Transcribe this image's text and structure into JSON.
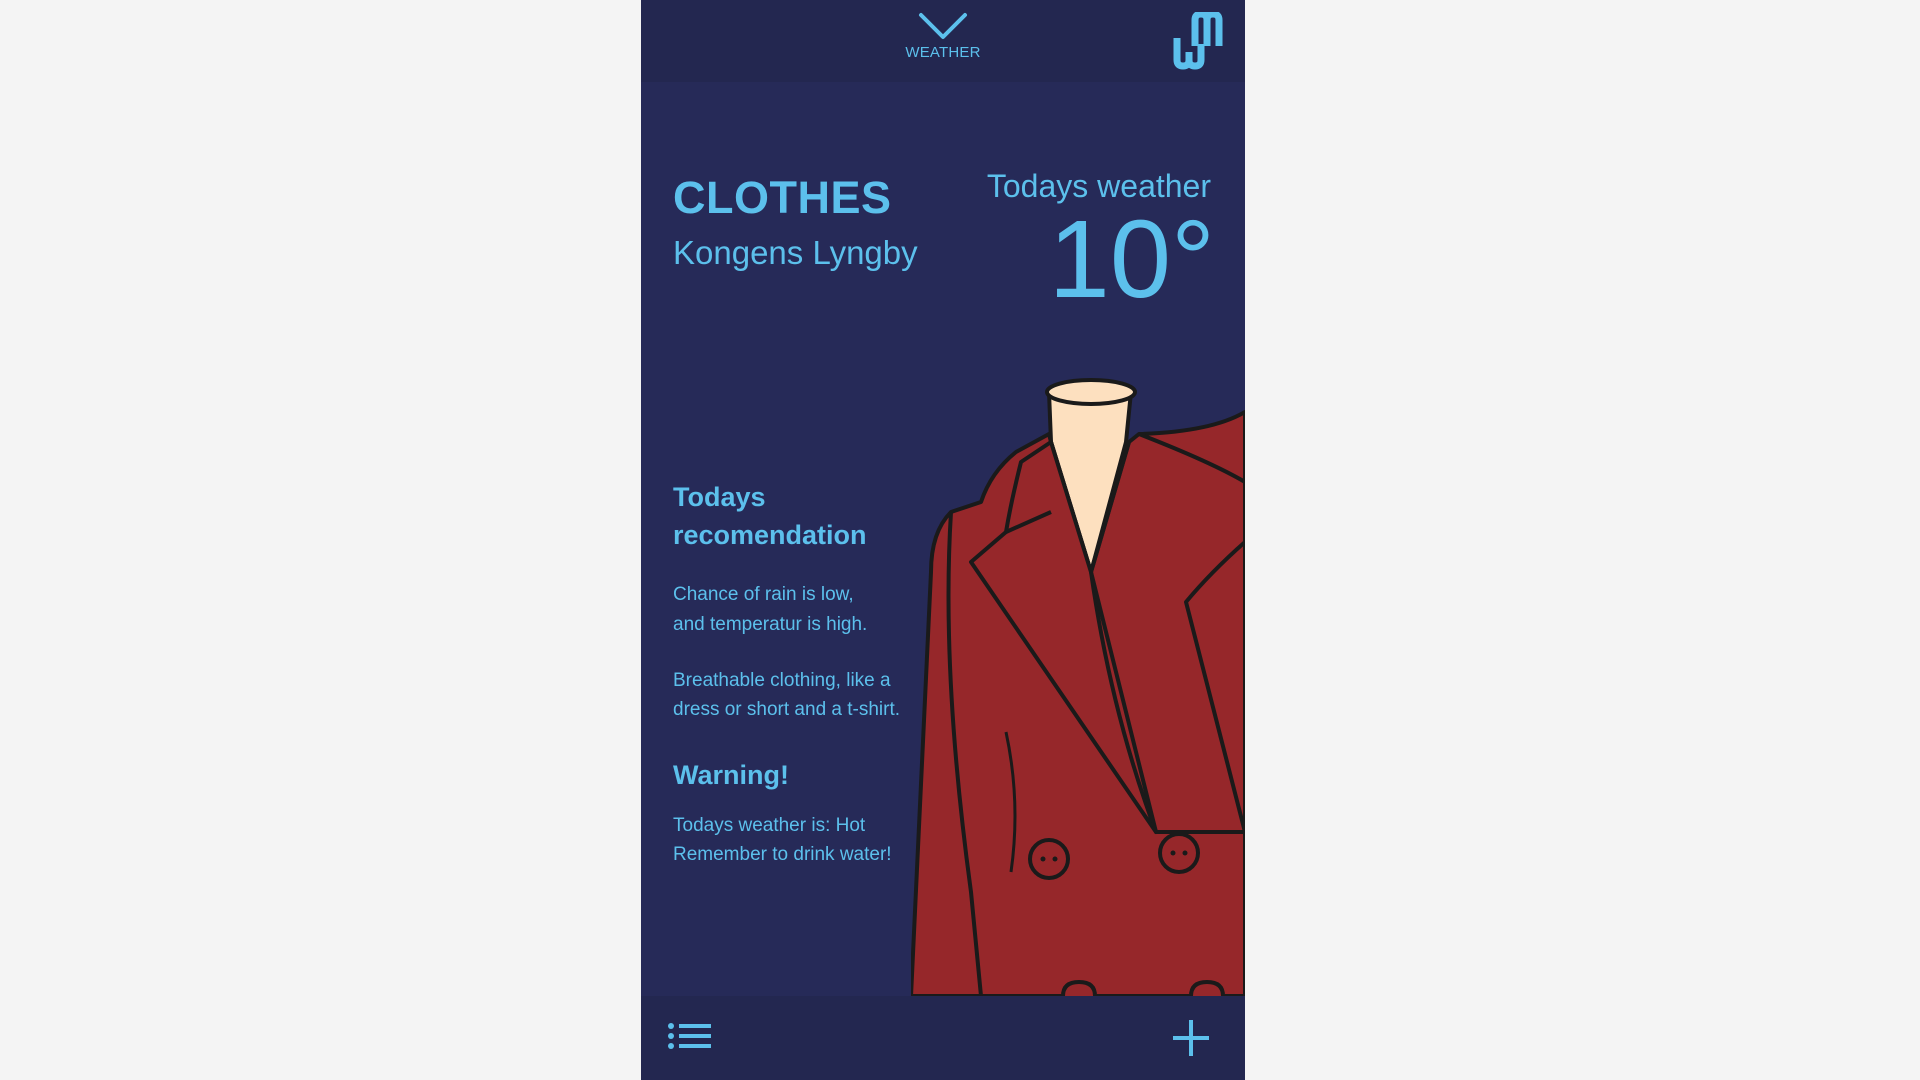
{
  "top_bar": {
    "collapse_label": "WEATHER",
    "collapse_icon": "chevron-down-icon",
    "logo_icon": "wm-logo-icon"
  },
  "header": {
    "title": "CLOTHES",
    "location": "Kongens Lyngby",
    "weather_label": "Todays weather",
    "temperature": "10°"
  },
  "recommendation": {
    "title": "Todays recomendation",
    "paragraph1": [
      "Chance of rain is low,",
      "and temperatur is high."
    ],
    "paragraph2": [
      "Breathable clothing, like a",
      "dress or short and a t-shirt."
    ]
  },
  "warning": {
    "title": "Warning!",
    "lines": [
      "Todays weather is: Hot",
      "Remember to drink water!"
    ]
  },
  "bottom_bar": {
    "menu_icon": "list-menu-icon",
    "add_icon": "plus-icon"
  },
  "colors": {
    "background": "#262a58",
    "bar": "#232750",
    "accent": "#5cc0ec",
    "coat": "#96272a",
    "skin": "#fde0bf",
    "page": "#f4f4f4"
  },
  "illustration": "coat-illustration"
}
